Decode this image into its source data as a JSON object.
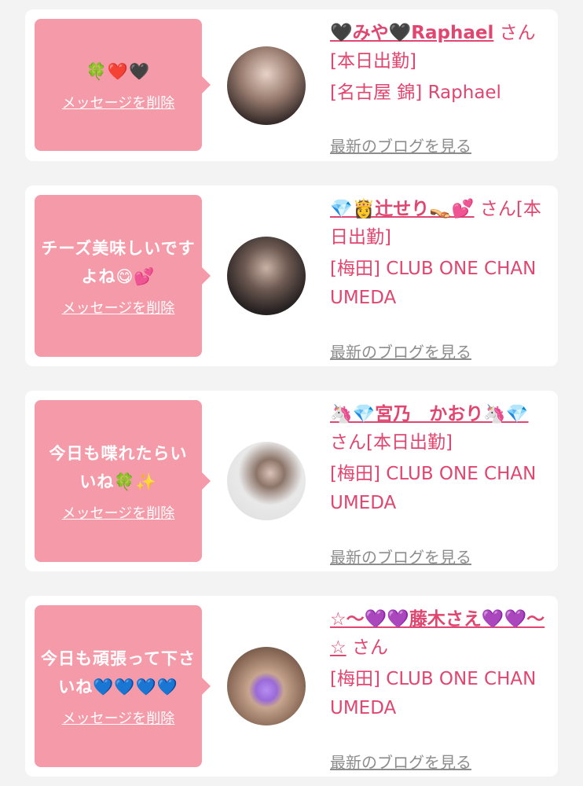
{
  "delete_label": "メッセージを削除",
  "blog_label": "最新のブログを見る",
  "entries": [
    {
      "message": "🍀❤️🖤",
      "name": "🖤みや🖤Raphael",
      "status": "さん[本日出勤]",
      "shop": "[名古屋 錦] Raphael"
    },
    {
      "message": "チーズ美味しいですよね😋💕",
      "name": "💎👸辻せり👡💕",
      "status": "さん[本日出勤]",
      "shop": "[梅田] CLUB ONE CHAN UMEDA"
    },
    {
      "message": "今日も喋れたらいいね🍀✨",
      "name": "🦄💎宮乃　かおり🦄💎",
      "status": "さん[本日出勤]",
      "shop": "[梅田] CLUB ONE CHAN UMEDA"
    },
    {
      "message": "今日も頑張って下さいね💙💙💙💙",
      "name": "☆〜💜💜藤木さえ💜💜〜☆",
      "status": "さん",
      "shop": "[梅田] CLUB ONE CHAN UMEDA"
    }
  ],
  "colors": {
    "bubble": "#f59aa8",
    "accent": "#e0466f",
    "muted": "#8d8d8d",
    "background": "#f3f3f3"
  }
}
